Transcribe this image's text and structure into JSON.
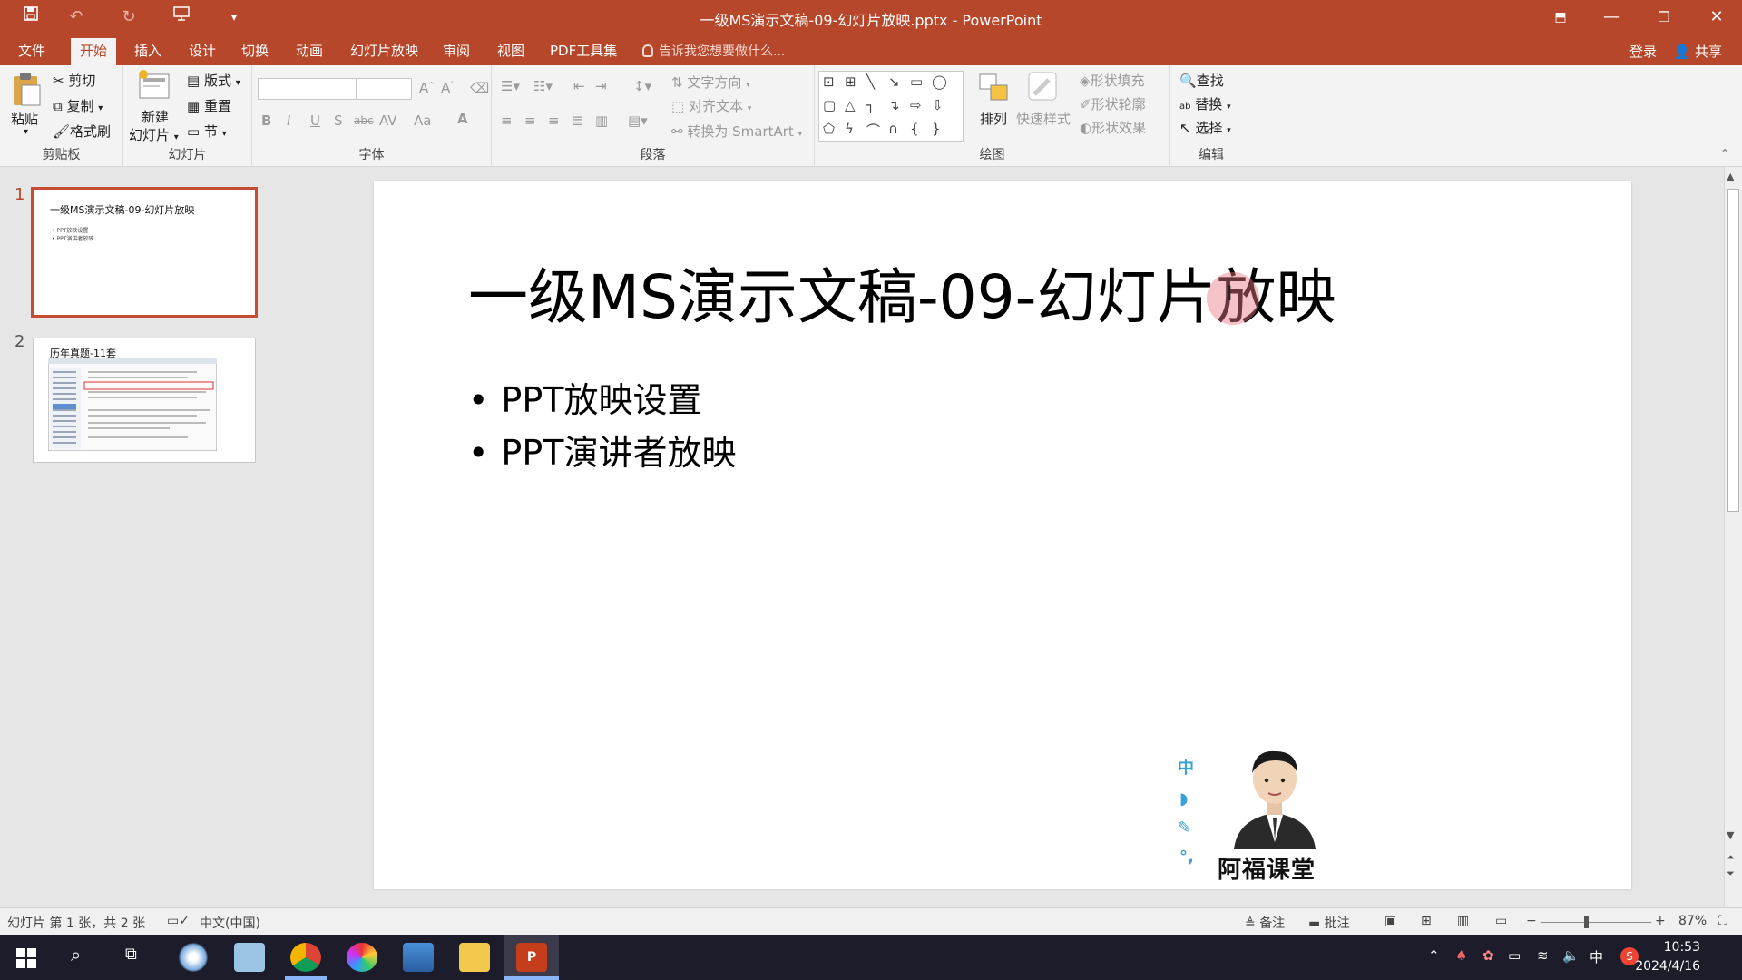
{
  "window": {
    "title": "一级MS演示文稿-09-幻灯片放映.pptx - PowerPoint"
  },
  "quick_access": {
    "save_icon": "save-icon",
    "undo_icon": "undo-icon",
    "redo_icon": "redo-icon",
    "present_icon": "start-from-beginning-icon",
    "customize_icon": "customize-qat-icon"
  },
  "tabs": [
    {
      "label": "文件"
    },
    {
      "label": "开始"
    },
    {
      "label": "插入"
    },
    {
      "label": "设计"
    },
    {
      "label": "切换"
    },
    {
      "label": "动画"
    },
    {
      "label": "幻灯片放映"
    },
    {
      "label": "审阅"
    },
    {
      "label": "视图"
    },
    {
      "label": "PDF工具集"
    }
  ],
  "active_tab": "开始",
  "tell_me": "告诉我您想要做什么...",
  "account": {
    "login": "登录",
    "share": "共享"
  },
  "ribbon": {
    "clipboard": {
      "paste": "粘贴",
      "cut": "剪切",
      "copy": "复制",
      "format_painter": "格式刷",
      "label": "剪贴板"
    },
    "slides": {
      "new_slide_line1": "新建",
      "new_slide_line2": "幻灯片",
      "layout": "版式",
      "reset": "重置",
      "section": "节",
      "label": "幻灯片"
    },
    "font": {
      "font_name": "",
      "font_size": "",
      "bold": "B",
      "italic": "I",
      "underline": "U",
      "shadow": "S",
      "strike": "abc",
      "spacing": "AV",
      "case": "Aa",
      "color": "A",
      "label": "字体"
    },
    "paragraph": {
      "text_direction": "文字方向",
      "align_text": "对齐文本",
      "convert_smartart": "转换为 SmartArt",
      "label": "段落"
    },
    "drawing": {
      "arrange": "排列",
      "quick_styles": "快速样式",
      "shape_fill": "形状填充",
      "shape_outline": "形状轮廓",
      "shape_effects": "形状效果",
      "label": "绘图"
    },
    "editing": {
      "find": "查找",
      "replace": "替换",
      "select": "选择",
      "label": "编辑"
    }
  },
  "thumbnails": [
    {
      "number": "1",
      "title": "一级MS演示文稿-09-幻灯片放映",
      "bullets": [
        "• PPT放映设置",
        "• PPT演讲者放映"
      ]
    },
    {
      "number": "2",
      "title": "历年真题-11套"
    }
  ],
  "slide": {
    "title": "一级MS演示文稿-09-幻灯片放映",
    "bullets": [
      "PPT放映设置",
      "PPT演讲者放映"
    ],
    "watermark": "阿福课堂",
    "side_chars": [
      "中",
      "◗",
      "✎",
      "°,"
    ]
  },
  "status": {
    "slide_info": "幻灯片 第 1 张，共 2 张",
    "language": "中文(中国)",
    "notes": "备注",
    "comments": "批注",
    "zoom": "87%"
  },
  "taskbar": {
    "ime": "中",
    "time": "10:53",
    "date": "2024/4/16"
  },
  "colors": {
    "accent": "#b7472a",
    "selected_thumb_border": "#c84b33"
  }
}
